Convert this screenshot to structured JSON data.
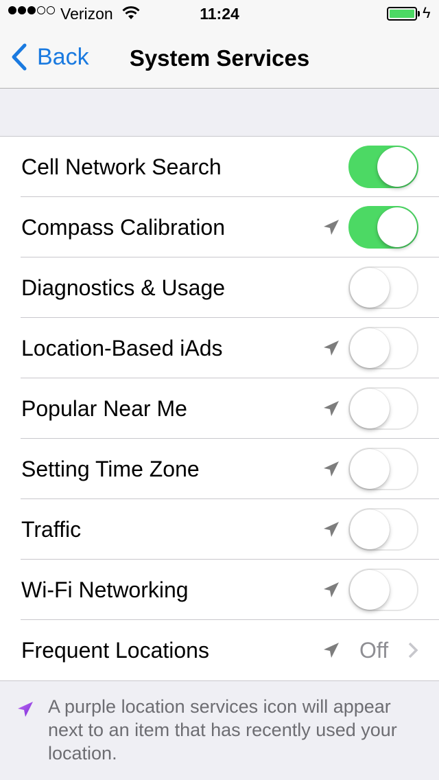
{
  "status_bar": {
    "signal_strength": "3 of 5",
    "carrier": "Verizon",
    "time": "11:24",
    "battery_level": 100,
    "charging": true,
    "charging_symbol": "ϟ"
  },
  "nav": {
    "back_label": "Back",
    "title": "System Services"
  },
  "services": [
    {
      "label": "Cell Network Search",
      "location_icon": false,
      "enabled": true
    },
    {
      "label": "Compass Calibration",
      "location_icon": true,
      "enabled": true
    },
    {
      "label": "Diagnostics & Usage",
      "location_icon": false,
      "enabled": false
    },
    {
      "label": "Location-Based iAds",
      "location_icon": true,
      "enabled": false
    },
    {
      "label": "Popular Near Me",
      "location_icon": true,
      "enabled": false
    },
    {
      "label": "Setting Time Zone",
      "location_icon": true,
      "enabled": false
    },
    {
      "label": "Traffic",
      "location_icon": true,
      "enabled": false
    },
    {
      "label": "Wi-Fi Networking",
      "location_icon": true,
      "enabled": false
    }
  ],
  "frequent_locations": {
    "label": "Frequent Locations",
    "value": "Off"
  },
  "footer": {
    "text": "A purple location services icon will appear next to an item that has recently used your location."
  },
  "colors": {
    "accent": "#1a7ae0",
    "toggle_on": "#4cd964",
    "location_purple": "#8e3ee0",
    "location_gray": "#7d7d7d"
  }
}
